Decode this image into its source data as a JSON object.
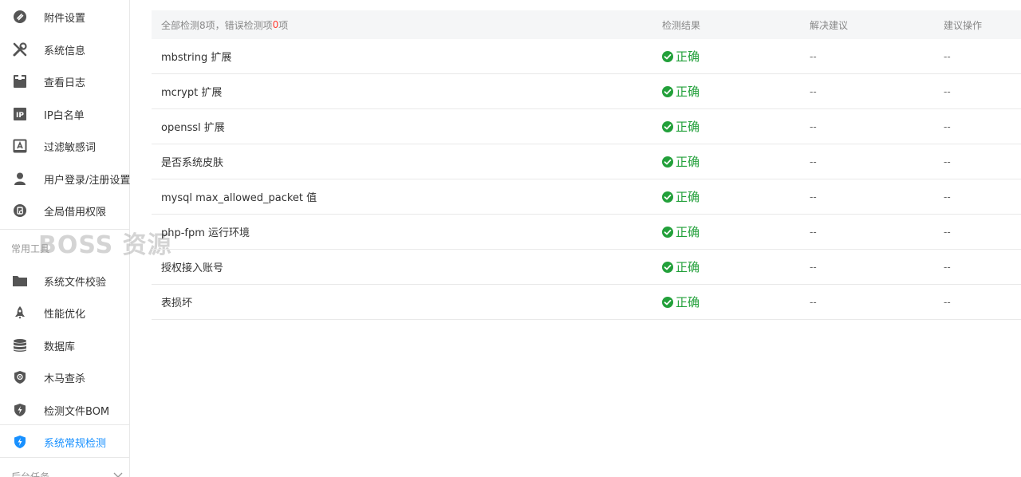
{
  "sidebar": {
    "items": [
      {
        "label": "附件设置",
        "icon": "attachment-icon"
      },
      {
        "label": "系统信息",
        "icon": "wrench-tools-icon"
      },
      {
        "label": "查看日志",
        "icon": "log-book-icon"
      },
      {
        "label": "IP白名单",
        "icon": "ip-icon"
      },
      {
        "label": "过滤敏感词",
        "icon": "filter-words-icon"
      },
      {
        "label": "用户登录/注册设置",
        "icon": "user-icon"
      },
      {
        "label": "全局借用权限",
        "icon": "permission-icon"
      }
    ],
    "section_tools": "常用工具",
    "tools": [
      {
        "label": "系统文件校验",
        "icon": "folder-icon"
      },
      {
        "label": "性能优化",
        "icon": "rocket-icon"
      },
      {
        "label": "数据库",
        "icon": "database-icon"
      },
      {
        "label": "木马查杀",
        "icon": "shield-scan-icon"
      },
      {
        "label": "检测文件BOM",
        "icon": "shield-bolt-icon"
      },
      {
        "label": "系统常规检测",
        "icon": "shield-bolt-active-icon",
        "active": true
      }
    ],
    "section_bottom": "后台任务"
  },
  "watermark": "BOSS 资源",
  "table": {
    "header": {
      "summary_prefix": "全部检测8项，错误检测项",
      "error_count": "0",
      "summary_suffix": "项",
      "result": "检测结果",
      "suggestion": "解决建议",
      "action": "建议操作"
    },
    "rows": [
      {
        "name": "mbstring 扩展",
        "result": "正确",
        "suggestion": "--",
        "action": "--"
      },
      {
        "name": "mcrypt 扩展",
        "result": "正确",
        "suggestion": "--",
        "action": "--"
      },
      {
        "name": "openssl 扩展",
        "result": "正确",
        "suggestion": "--",
        "action": "--"
      },
      {
        "name": "是否系统皮肤",
        "result": "正确",
        "suggestion": "--",
        "action": "--"
      },
      {
        "name": "mysql max_allowed_packet 值",
        "result": "正确",
        "suggestion": "--",
        "action": "--"
      },
      {
        "name": "php-fpm 运行环境",
        "result": "正确",
        "suggestion": "--",
        "action": "--"
      },
      {
        "name": "授权接入账号",
        "result": "正确",
        "suggestion": "--",
        "action": "--"
      },
      {
        "name": "表损坏",
        "result": "正确",
        "suggestion": "--",
        "action": "--"
      }
    ]
  },
  "colors": {
    "accent": "#1890ff",
    "success": "#22a03a",
    "error": "#ff3b30",
    "icon": "#555555"
  }
}
